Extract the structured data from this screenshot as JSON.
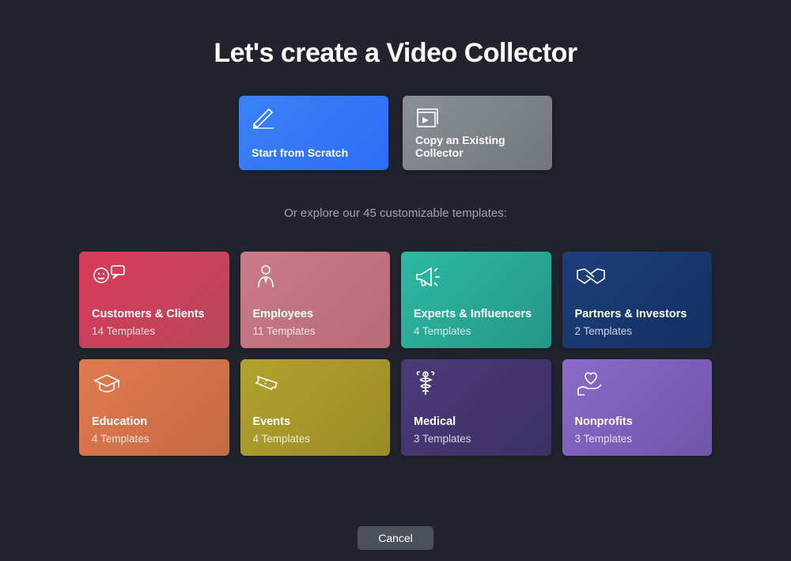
{
  "title": "Let's create a Video Collector",
  "actions": {
    "scratch": "Start from Scratch",
    "copy": "Copy an Existing Collector"
  },
  "subtext": "Or explore our 45 customizable templates:",
  "categories": [
    {
      "name": "Customers & Clients",
      "count": "14 Templates",
      "bg": "linear-gradient(135deg,#d93a5a,#b8475a)"
    },
    {
      "name": "Employees",
      "count": "11 Templates",
      "bg": "linear-gradient(135deg,#c97b8a,#b76a79)"
    },
    {
      "name": "Experts & Influencers",
      "count": "4 Templates",
      "bg": "linear-gradient(135deg,#2db9a3,#259688)"
    },
    {
      "name": "Partners & Investors",
      "count": "2 Templates",
      "bg": "linear-gradient(135deg,#1d3f7a,#153063)"
    },
    {
      "name": "Education",
      "count": "4 Templates",
      "bg": "linear-gradient(135deg,#e07a4f,#c46a44)"
    },
    {
      "name": "Events",
      "count": "4 Templates",
      "bg": "linear-gradient(135deg,#b2a22e,#9a8c26)"
    },
    {
      "name": "Medical",
      "count": "3 Templates",
      "bg": "linear-gradient(135deg,#4b3a7a,#3d2f66)"
    },
    {
      "name": "Nonprofits",
      "count": "3 Templates",
      "bg": "linear-gradient(135deg,#8a6bc9,#6f54ad)"
    }
  ],
  "cancel": "Cancel"
}
